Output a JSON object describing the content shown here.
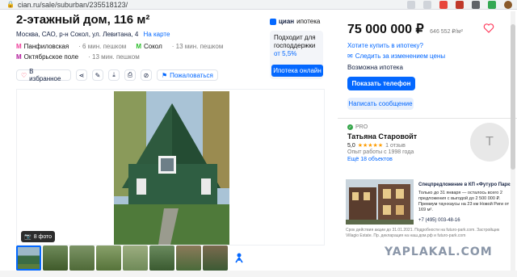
{
  "browser": {
    "url": "cian.ru/sale/suburban/235518123/"
  },
  "listing": {
    "title": "2-этажный дом, 116 м²",
    "address": "Москва, САО, р-н Сокол, ул. Левитана, 4",
    "map_link": "На карте",
    "metro": [
      {
        "name": "Панфиловская",
        "time": "· 6 мин. пешком",
        "color": "#ef3e9b"
      },
      {
        "name": "Сокол",
        "time": "· 13 мин. пешком",
        "color": "#2dbe2c"
      },
      {
        "name": "Октябрьское поле",
        "time": "· 13 мин. пешком",
        "color": "#b1179a"
      }
    ],
    "actions": {
      "favorites": "В избранное",
      "complain": "Пожаловаться"
    }
  },
  "ipoteka": {
    "brand": "циан",
    "brand_suffix": "ипотека",
    "promo_line1": "Подходит для господдержки",
    "promo_rate": "от 5,5%",
    "button": "Ипотека онлайн"
  },
  "gallery": {
    "photo_count": "8 фото"
  },
  "right": {
    "price": "75 000 000 ₽",
    "price_per_m2": "646 552 ₽/м²",
    "buy_link": "Хотите купить в ипотеку?",
    "follow": "Следить за изменением цены",
    "mortgage": "Возможна ипотека",
    "phone_button": "Показать телефон",
    "message_button": "Написать сообщение"
  },
  "agent": {
    "badge": "PRO",
    "name": "Татьяна Старовойт",
    "rating": "5,0",
    "stars": "★★★★★",
    "reviews": "1 отзыв",
    "experience": "Опыт работы с 1998 года",
    "objects": "Ещё 18 объектов",
    "avatar_letter": "Т"
  },
  "ad": {
    "title": "Спецпредложение в КП «Футуро Парк»",
    "text": "Только до 31 января — осталось всего 2 предложения с выгодой до 2 500 000 ₽. Премиум таунхаусы на 23 км Новой Риги от 169 м².",
    "phone": "+7 (495) 003-48-16",
    "footer": "Срок действия акции до 31.01.2021. Подробности на futuro-park.com. Застройщик Villagio Estate. Пр. декларация на наш.дом.рф и futuro-park.com"
  },
  "watermark": "YAPLAKAL.COM",
  "colors": {
    "accent": "#0468ff",
    "price_text": "#121212",
    "star": "#ff9d00"
  }
}
